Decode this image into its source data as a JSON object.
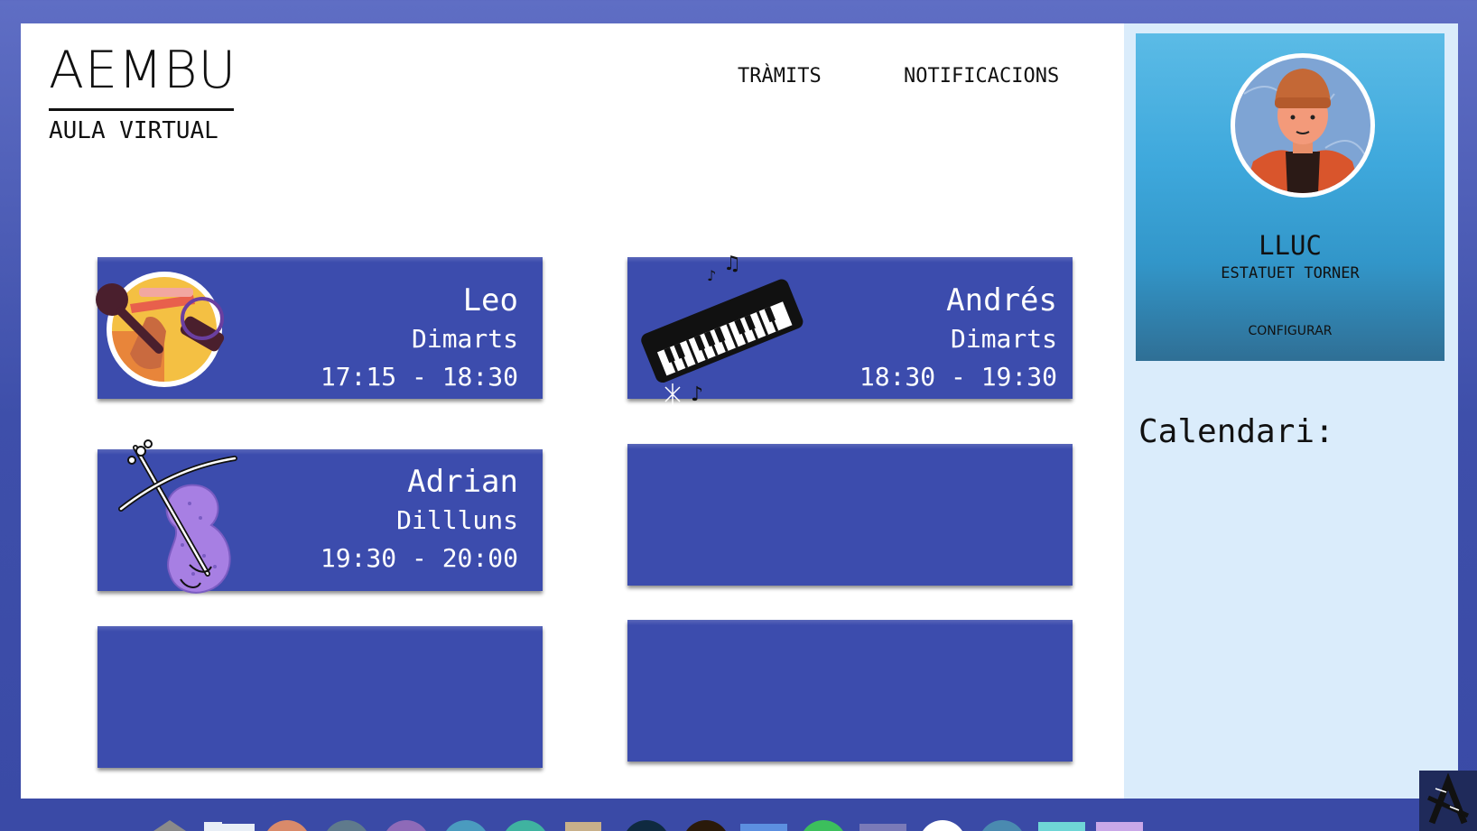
{
  "header": {
    "logo_title": "AEMBU",
    "logo_subtitle": "AULA VIRTUAL",
    "nav": {
      "tramits": "TRÀMITS",
      "notificacions": "NOTIFICACIONS"
    }
  },
  "classes": [
    {
      "name": "Leo",
      "day": "Dimarts",
      "time": "17:15 - 18:30",
      "icon": "microphone-sunglasses-icon"
    },
    {
      "name": "Andrés",
      "day": "Dimarts",
      "time": "18:30 - 19:30",
      "icon": "keyboard-piano-icon"
    },
    {
      "name": "Adrian",
      "day": "Dillluns",
      "time": "19:30 - 20:00",
      "icon": "violin-icon"
    }
  ],
  "profile": {
    "name": "LLUC",
    "role": "ESTATUET TORNER",
    "config_label": "CONFIGURAR",
    "avatar_icon": "user-avatar-icon"
  },
  "calendar": {
    "label": "Calendari:"
  },
  "colors": {
    "card": "#3c4cad",
    "desktop": "#3e4faa",
    "side_panel": "#daecfb",
    "profile_card": "#3ea8dc"
  },
  "dock": {
    "icons": [
      "home-icon",
      "folder-icon",
      "app-icon",
      "app-icon",
      "app-icon",
      "app-icon",
      "app-icon",
      "app-icon",
      "app-icon",
      "app-icon",
      "app-icon",
      "app-icon",
      "app-icon",
      "app-icon",
      "app-icon",
      "app-icon",
      "app-icon"
    ]
  }
}
